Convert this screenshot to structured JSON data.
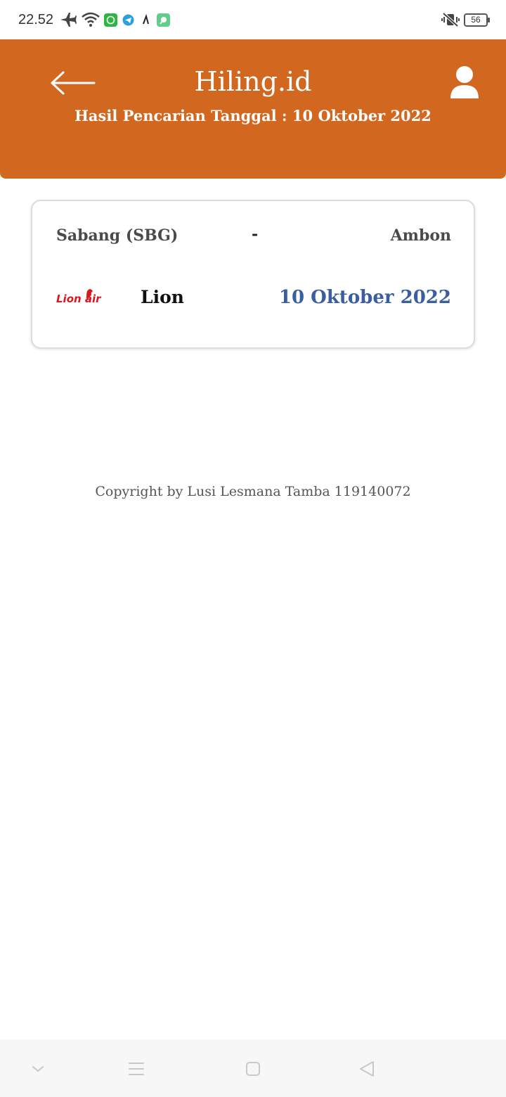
{
  "status_bar": {
    "time": "22.52",
    "battery_level": "56",
    "icons_left": [
      "airplane-mode-icon",
      "wifi-icon",
      "whatsapp-icon",
      "telegram-icon",
      "sound-app-icon",
      "chat-app-icon"
    ],
    "icons_right": [
      "vibrate-mute-icon",
      "battery-icon"
    ]
  },
  "header": {
    "title": "Hiling.id",
    "subtitle": "Hasil Pencarian Tanggal : 10 Oktober 2022",
    "background_color": "#d2681f"
  },
  "result": {
    "origin": "Sabang (SBG)",
    "separator": "-",
    "destination": "Ambon",
    "airline_logo_text": "Lion air",
    "airline_name": "Lion",
    "date": "10 Oktober 2022",
    "date_color": "#3b5ea0"
  },
  "footer": {
    "copyright": "Copyright by Lusi Lesmana Tamba 119140072"
  },
  "nav_bar": {
    "buttons": [
      "collapse-icon",
      "menu-icon",
      "home-icon",
      "back-icon"
    ]
  }
}
